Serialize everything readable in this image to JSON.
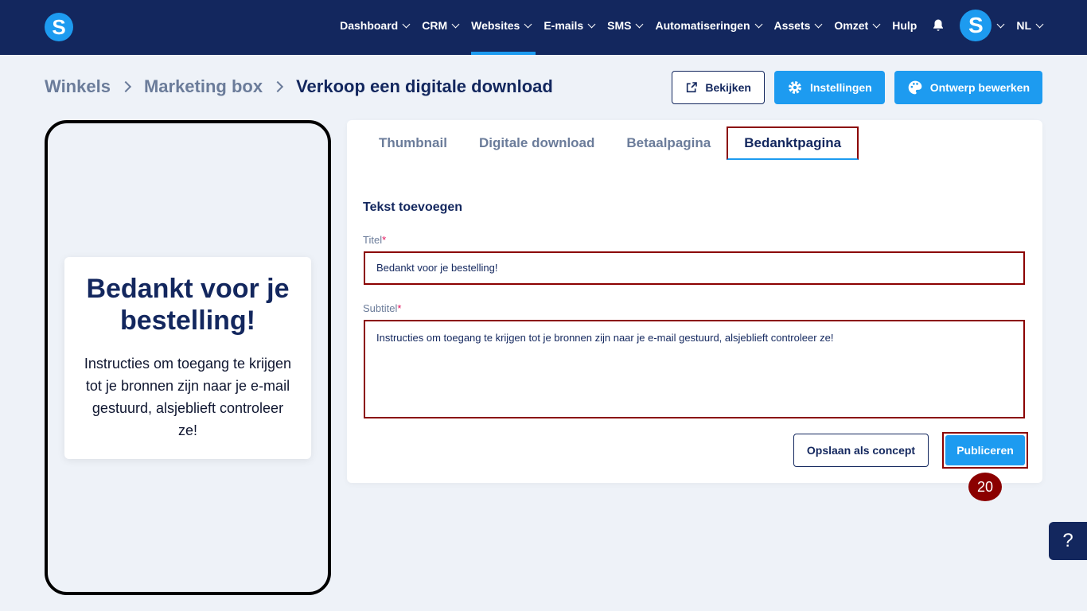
{
  "nav": {
    "items": [
      {
        "label": "Dashboard",
        "chevron": true
      },
      {
        "label": "CRM",
        "chevron": true
      },
      {
        "label": "Websites",
        "chevron": true,
        "active": true
      },
      {
        "label": "E-mails",
        "chevron": true
      },
      {
        "label": "SMS",
        "chevron": true
      },
      {
        "label": "Automatiseringen",
        "chevron": true
      },
      {
        "label": "Assets",
        "chevron": true
      },
      {
        "label": "Omzet",
        "chevron": true
      },
      {
        "label": "Hulp",
        "chevron": false
      }
    ],
    "logo_letter": "S",
    "avatar_letter": "S",
    "language": "NL"
  },
  "breadcrumb": {
    "item1": "Winkels",
    "item2": "Marketing box",
    "current": "Verkoop een digitale download"
  },
  "header_buttons": {
    "view": "Bekijken",
    "settings": "Instellingen",
    "design": "Ontwerp bewerken"
  },
  "preview": {
    "title": "Bedankt voor je bestelling!",
    "subtitle": "Instructies om toegang te krijgen tot je bronnen zijn naar je e-mail gestuurd, alsjeblieft controleer ze!"
  },
  "tabs": {
    "thumbnail": "Thumbnail",
    "download": "Digitale download",
    "payment": "Betaalpagina",
    "thanks": "Bedanktpagina"
  },
  "form": {
    "section_title": "Tekst toevoegen",
    "title_label": "Titel",
    "title_value": "Bedankt voor je bestelling!",
    "subtitle_label": "Subtitel",
    "subtitle_value": "Instructies om toegang te krijgen tot je bronnen zijn naar je e-mail gestuurd, alsjeblieft controleer ze!",
    "required_mark": "*"
  },
  "actions": {
    "save_draft": "Opslaan als concept",
    "publish": "Publiceren"
  },
  "step_badge": "20",
  "help": "?",
  "colors": {
    "navbar": "#13275e",
    "accent": "#1d9bf0",
    "highlight": "#8b0000"
  }
}
